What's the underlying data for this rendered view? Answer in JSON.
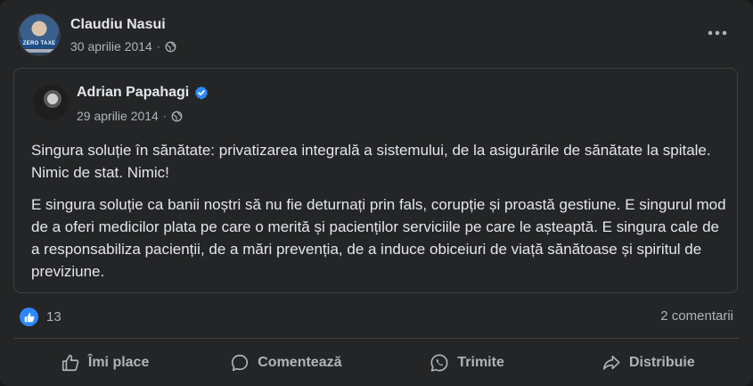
{
  "post": {
    "author": "Claudiu Nasui",
    "date": "30 aprilie 2014",
    "separator": "·",
    "avatar_text": "ZERO TAXE"
  },
  "shared": {
    "author": "Adrian Papahagi",
    "date": "29 aprilie 2014",
    "separator": "·",
    "paragraphs": [
      "Singura soluție în sănătate: privatizarea integrală a sistemului, de la asigurările de sănătate la spitale. Nimic de stat. Nimic!",
      "E singura soluție ca banii noștri să nu fie deturnați prin fals, corupție și proastă gestiune. E singurul mod de a oferi medicilor plata pe care o merită și pacienților serviciile pe care le așteaptă. E singura cale de a responsabiliza pacienții, de a mări prevenția, de a induce obiceiuri de viață sănătoase și spiritul de previziune."
    ]
  },
  "stats": {
    "likes": "13",
    "comments": "2 comentarii"
  },
  "actions": {
    "like": "Îmi place",
    "comment": "Comentează",
    "send": "Trimite",
    "share": "Distribuie"
  },
  "colors": {
    "background": "#242526",
    "text": "#e4e6eb",
    "secondary": "#b0b3b8",
    "accent": "#2d88ff"
  },
  "icons": [
    "globe-icon",
    "more-icon",
    "verified-icon",
    "like-icon",
    "comment-icon",
    "whatsapp-icon",
    "share-icon"
  ]
}
